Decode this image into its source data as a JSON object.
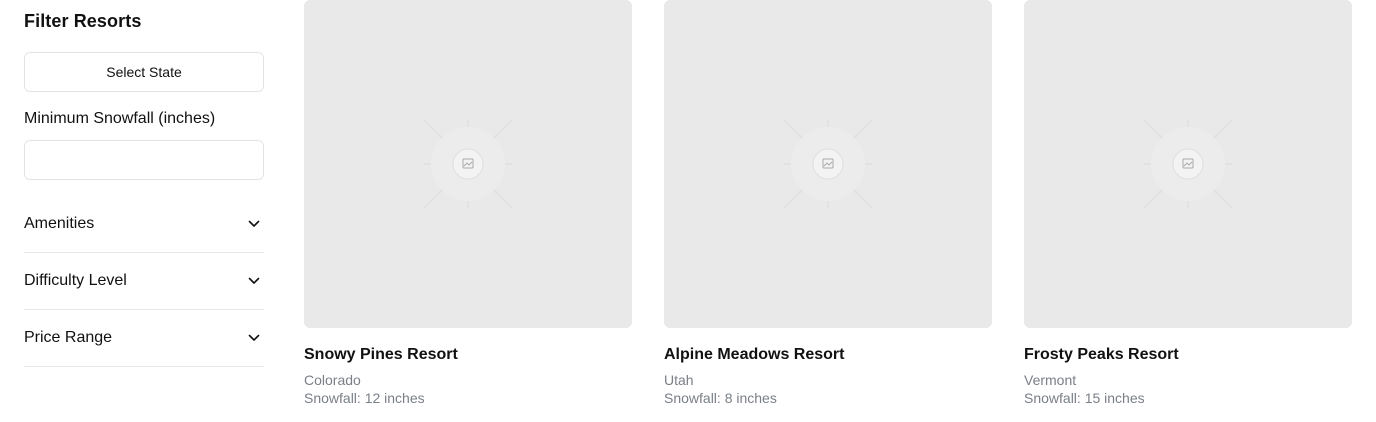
{
  "sidebar": {
    "title": "Filter Resorts",
    "select_state_label": "Select State",
    "min_snowfall_label": "Minimum Snowfall (inches)",
    "min_snowfall_value": "",
    "min_snowfall_placeholder": "",
    "sections": [
      {
        "label": "Amenities",
        "icon": "chevron-down-icon"
      },
      {
        "label": "Difficulty Level",
        "icon": "chevron-down-icon"
      },
      {
        "label": "Price Range",
        "icon": "chevron-down-icon"
      }
    ]
  },
  "resorts": [
    {
      "name": "Snowy Pines Resort",
      "state": "Colorado",
      "snowfall": "Snowfall: 12 inches",
      "image_icon": "image-placeholder-icon"
    },
    {
      "name": "Alpine Meadows Resort",
      "state": "Utah",
      "snowfall": "Snowfall: 8 inches",
      "image_icon": "image-placeholder-icon"
    },
    {
      "name": "Frosty Peaks Resort",
      "state": "Vermont",
      "snowfall": "Snowfall: 15 inches",
      "image_icon": "image-placeholder-icon"
    }
  ],
  "colors": {
    "placeholder_bg": "#e9e9e9",
    "muted_text": "#7a7f87",
    "border": "#e3e3e3"
  }
}
